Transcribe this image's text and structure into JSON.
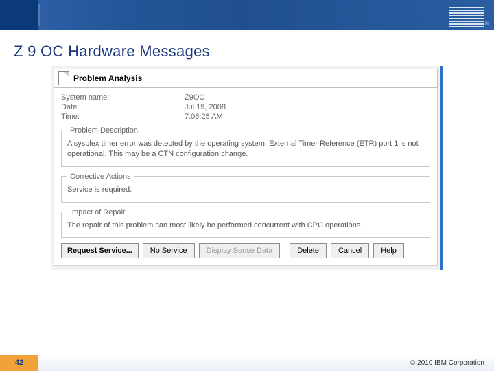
{
  "slide": {
    "title": "Z 9 OC Hardware Messages",
    "page": "42",
    "copyright": "© 2010 IBM Corporation"
  },
  "window": {
    "title": "Problem Analysis",
    "fields": {
      "system_name_label": "System name:",
      "system_name_value": "Z9OC",
      "date_label": "Date:",
      "date_value": "Jul 19, 2008",
      "time_label": "Time:",
      "time_value": "7:06:25 AM"
    },
    "sections": {
      "problem_description": {
        "legend": "Problem Description",
        "text": "A sysplex timer error was detected by the operating system. External Timer Reference (ETR) port 1 is not operational. This may be a CTN configuration change."
      },
      "corrective_actions": {
        "legend": "Corrective Actions",
        "text": "Service is required."
      },
      "impact_of_repair": {
        "legend": "Impact of Repair",
        "text": "The repair of this problem can most likely be performed concurrent with CPC operations."
      }
    },
    "buttons": {
      "request_service": "Request Service...",
      "no_service": "No Service",
      "display_sense": "Display Sense Data",
      "delete": "Delete",
      "cancel": "Cancel",
      "help": "Help"
    }
  }
}
